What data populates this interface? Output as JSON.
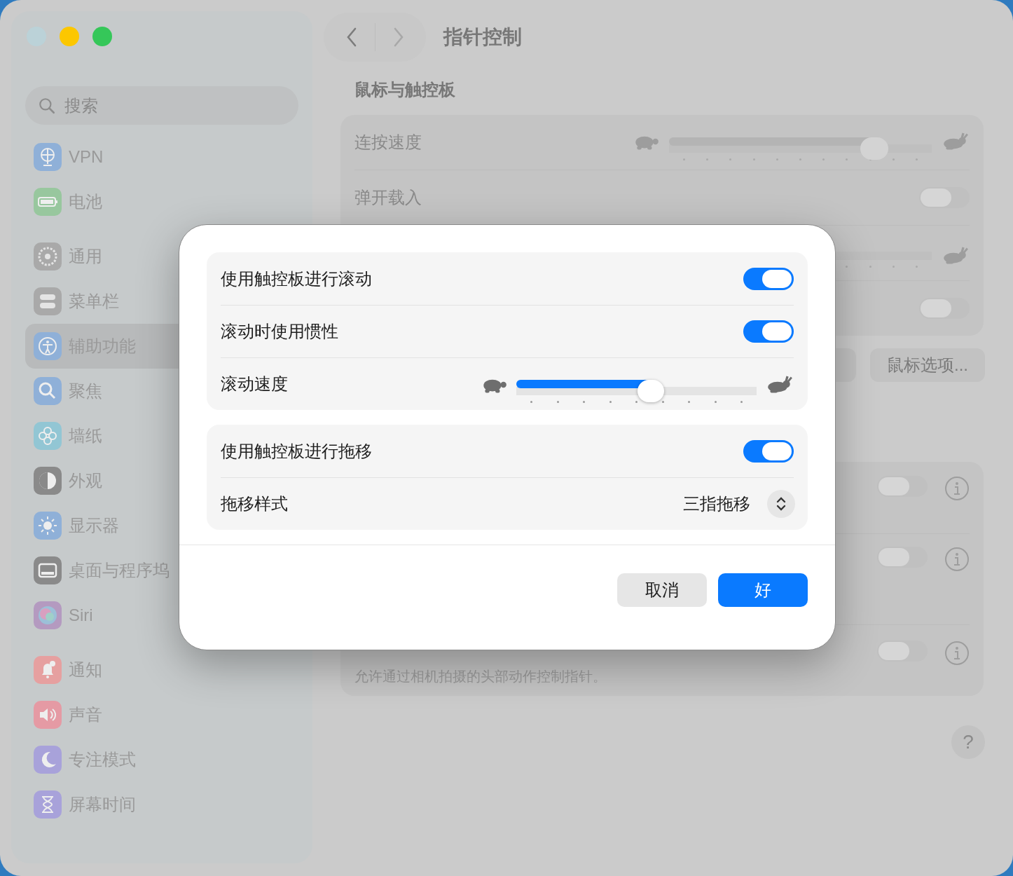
{
  "window": {
    "traffic_lights": [
      {
        "kind": "close",
        "disabled": true
      },
      {
        "kind": "minimize",
        "disabled": false
      },
      {
        "kind": "zoom",
        "disabled": false
      }
    ]
  },
  "sidebar": {
    "search": {
      "placeholder": "搜索"
    },
    "groups": [
      [
        {
          "kind": "vpn",
          "label": "VPN",
          "selected": false
        },
        {
          "kind": "battery",
          "label": "电池",
          "selected": false
        }
      ],
      [
        {
          "kind": "general",
          "label": "通用",
          "selected": false
        },
        {
          "kind": "menubar",
          "label": "菜单栏",
          "selected": false
        },
        {
          "kind": "accessibility",
          "label": "辅助功能",
          "selected": true
        },
        {
          "kind": "spotlight",
          "label": "聚焦",
          "selected": false
        },
        {
          "kind": "wallpaper",
          "label": "墙纸",
          "selected": false
        },
        {
          "kind": "appearance",
          "label": "外观",
          "selected": false
        },
        {
          "kind": "display",
          "label": "显示器",
          "selected": false
        },
        {
          "kind": "dock",
          "label": "桌面与程序坞",
          "selected": false
        },
        {
          "kind": "siri",
          "label": "Siri",
          "selected": false
        }
      ],
      [
        {
          "kind": "notifications",
          "label": "通知",
          "selected": false
        },
        {
          "kind": "sound",
          "label": "声音",
          "selected": false
        },
        {
          "kind": "focus",
          "label": "专注模式",
          "selected": false
        },
        {
          "kind": "screentime",
          "label": "屏幕时间",
          "selected": false
        }
      ]
    ]
  },
  "main": {
    "nav_buttons": [
      {
        "kind": "back",
        "disabled": false
      },
      {
        "kind": "forward",
        "disabled": true
      }
    ],
    "title": "指针控制",
    "section_title": "鼠标与触控板",
    "card_rows": [
      {
        "kind": "slider",
        "label": "连按速度",
        "level": 0.78
      },
      {
        "kind": "toggle",
        "label": "弹开载入",
        "on": false
      },
      {
        "kind": "slider"
      },
      {
        "kind": "toggle",
        "on": false
      }
    ],
    "button": "鼠标选项...",
    "card2_rows": [
      {
        "on": false
      },
      {
        "on": false
      },
      {
        "description": "允许通过相机拍摄的头部动作控制指针。",
        "on": false
      }
    ],
    "help": "?"
  },
  "dialog": {
    "groups": [
      [
        {
          "kind": "toggle",
          "label": "使用触控板进行滚动",
          "on": true
        },
        {
          "kind": "toggle",
          "label": "滚动时使用惯性",
          "on": true
        },
        {
          "kind": "slider",
          "label": "滚动速度",
          "level": 0.56
        }
      ],
      [
        {
          "kind": "toggle",
          "label": "使用触控板进行拖移",
          "on": true
        },
        {
          "kind": "popup",
          "label": "拖移样式",
          "value": "三指拖移"
        }
      ]
    ],
    "buttons": [
      {
        "kind": "cancel",
        "label": "取消"
      },
      {
        "kind": "default",
        "label": "好"
      }
    ]
  }
}
